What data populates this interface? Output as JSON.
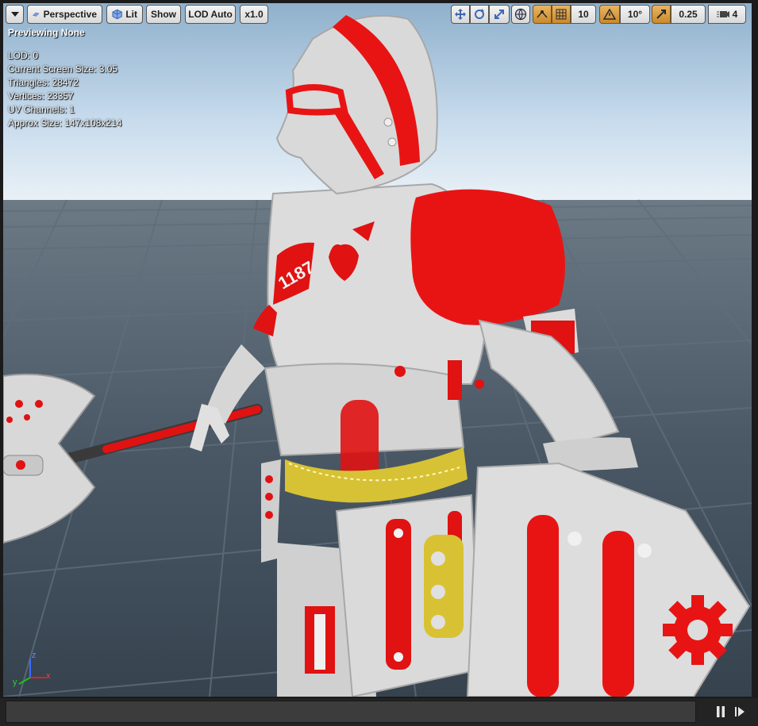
{
  "toolbar": {
    "perspective_label": "Perspective",
    "lit_label": "Lit",
    "show_label": "Show",
    "lod_label": "LOD Auto",
    "speed_label": "x1.0",
    "grid_snap_value": "10",
    "rotation_snap_value": "10°",
    "scale_snap_value": "0.25",
    "camera_speed_value": "4"
  },
  "overlay": {
    "title": "Previewing None",
    "stats": [
      "LOD: 0",
      "Current Screen Size: 3.05",
      "Triangles: 28472",
      "Vertices: 23357",
      "UV Channels: 1",
      "Approx Size: 147x108x214"
    ]
  },
  "axis": {
    "z": "z",
    "x": "x",
    "y": "y"
  },
  "colors": {
    "accent_orange": "#d99a3c",
    "armor_red": "#e81414",
    "armor_white": "#dcdcdc",
    "floor": "#4a5a68"
  },
  "icons": [
    "dropdown-icon",
    "perspective-icon",
    "lit-cube-icon",
    "translate-icon",
    "rotate-icon",
    "scale-icon",
    "world-space-icon",
    "surface-snap-icon",
    "grid-icon",
    "rotation-snap-icon",
    "scale-snap-icon",
    "camera-speed-icon",
    "pause-icon",
    "step-forward-icon"
  ]
}
